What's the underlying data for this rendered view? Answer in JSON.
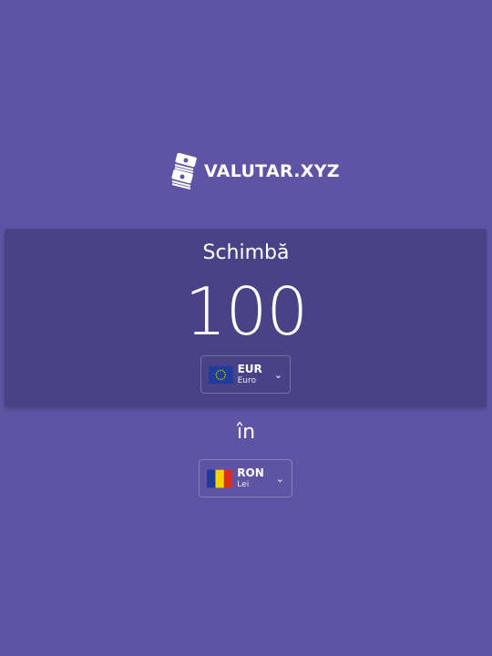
{
  "logo": {
    "text": "VALUTAR.XYZ",
    "icon": "money-stack-icon"
  },
  "converter": {
    "title": "Schimbă",
    "amount": "100",
    "in_label": "în",
    "from": {
      "code": "EUR",
      "name": "Euro",
      "icon": "eu-flag-icon"
    },
    "to": {
      "code": "RON",
      "name": "Lei",
      "icon": "romania-flag-icon"
    }
  },
  "colors": {
    "background": "#5e54a3",
    "card": "#4a4286"
  }
}
